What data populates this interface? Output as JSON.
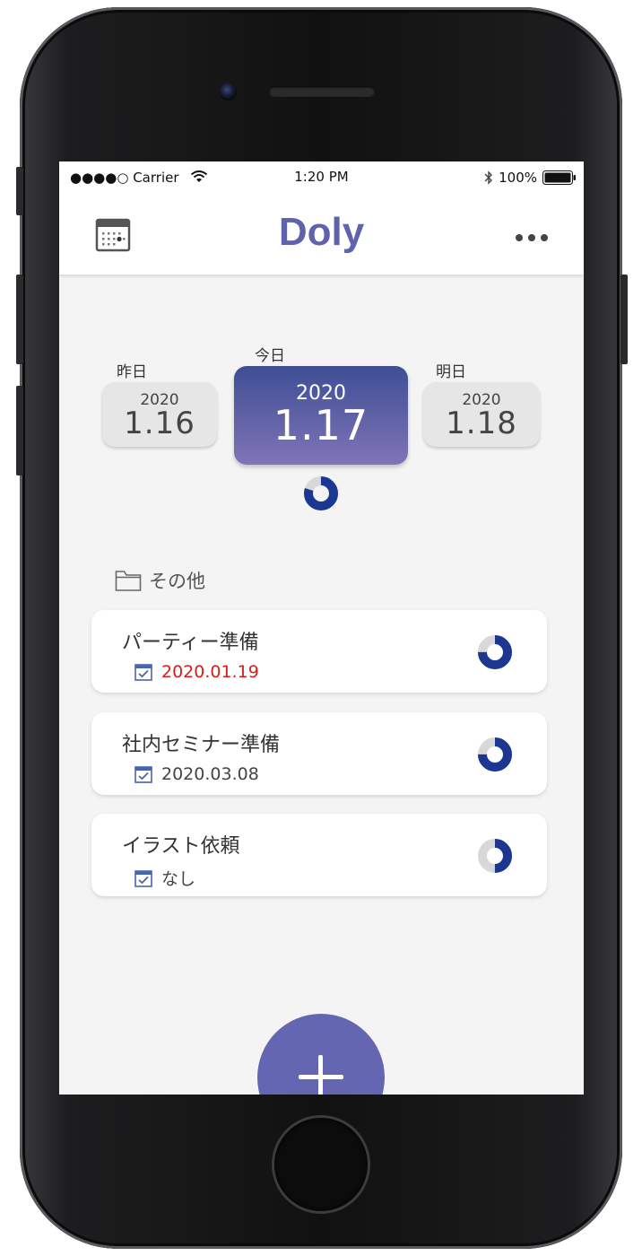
{
  "status_bar": {
    "carrier": "●●●●○ Carrier",
    "time": "1:20 PM",
    "battery": "100%"
  },
  "app": {
    "title": "Doly",
    "accent": "#5f62ad"
  },
  "days": {
    "prev": {
      "label": "昨日",
      "year": "2020",
      "date": "1.16"
    },
    "today": {
      "label": "今日",
      "year": "2020",
      "date": "1.17"
    },
    "next": {
      "label": "明日",
      "year": "2020",
      "date": "1.18"
    }
  },
  "folder": {
    "name": "その他"
  },
  "tasks": [
    {
      "name": "パーティー準備",
      "due": "2020.01.19",
      "overdue": true,
      "progress": 0.75
    },
    {
      "name": "社内セミナー準備",
      "due": "2020.03.08",
      "overdue": false,
      "progress": 0.75
    },
    {
      "name": "イラスト依頼",
      "due": "なし",
      "overdue": false,
      "progress": 0.5
    }
  ],
  "today_progress": 0.8,
  "colors": {
    "progress": "#1b3791",
    "track": "#d8d8d8",
    "overdue": "#d51f1f",
    "fab": "#6466b1"
  }
}
